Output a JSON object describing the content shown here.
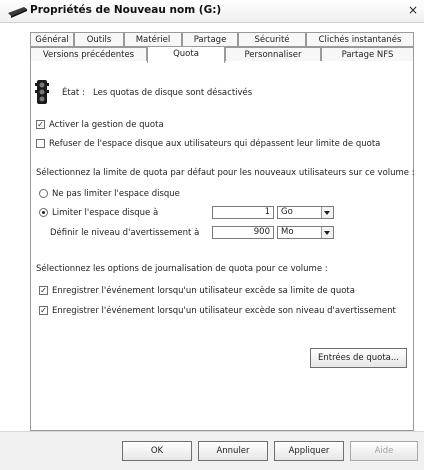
{
  "window": {
    "title": "Propriétés de Nouveau nom (G:)",
    "close_glyph": "×"
  },
  "tabs": {
    "row1": [
      "Général",
      "Outils",
      "Matériel",
      "Partage",
      "Sécurité",
      "Clichés instantanés"
    ],
    "row2": [
      "Versions précédentes",
      "Quota",
      "Personnaliser",
      "Partage NFS"
    ],
    "active": "Quota"
  },
  "status": {
    "label": "État :",
    "text": "Les quotas de disque sont désactivés"
  },
  "options": {
    "enable_quota": {
      "label": "Activer la gestion de quota",
      "checked": true
    },
    "deny_space": {
      "label": "Refuser de l'espace disque aux utilisateurs qui dépassent leur limite de quota",
      "checked": false
    }
  },
  "default_limit": {
    "heading": "Sélectionnez la limite de quota par défaut pour les nouveaux utilisateurs sur ce volume :",
    "no_limit_label": "Ne pas limiter l'espace disque",
    "limit_label": "Limiter l'espace disque à",
    "limit_value": "1",
    "limit_unit": "Go",
    "warning_label": "Définir le niveau d'avertissement à",
    "warning_value": "900",
    "warning_unit": "Mo",
    "selected": "limit"
  },
  "logging": {
    "heading": "Sélectionnez les options de journalisation de quota pour ce volume :",
    "log_limit": {
      "label": "Enregistrer l'événement lorsqu'un utilisateur excède sa limite de quota",
      "checked": true
    },
    "log_warning": {
      "label": "Enregistrer l'événement lorsqu'un utilisateur excède son niveau d'avertissement",
      "checked": true
    }
  },
  "buttons": {
    "quota_entries": "Entrées de quota...",
    "ok": "OK",
    "cancel": "Annuler",
    "apply": "Appliquer",
    "help": "Aide"
  },
  "check_glyph": "✓"
}
